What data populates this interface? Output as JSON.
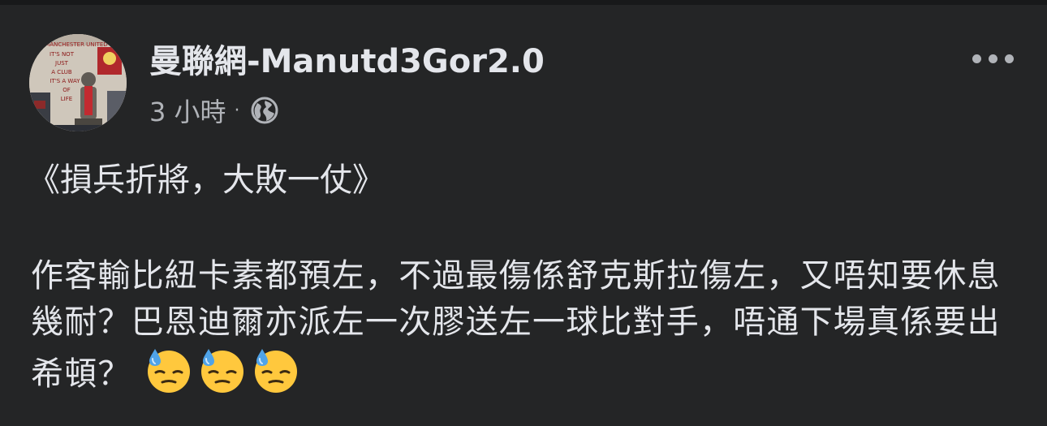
{
  "post": {
    "author": "曼聯網-Manutd3Gor2.0",
    "timestamp": "3 小時",
    "separator": "·",
    "audience_icon": "globe-icon",
    "more_icon": "more-options-icon",
    "avatar_text": [
      "MANCHESTER UNITED",
      "IT'S NOT",
      "JUST",
      "A CLUB",
      "IT'S A WAY",
      "OF",
      "LIFE"
    ],
    "title": "《損兵折將，大敗一仗》",
    "body": "作客輸比紐卡素都預左，不過最傷係舒克斯拉傷左，又唔知要休息幾耐？巴恩迪爾亦派左一次膠送左一球比對手，唔通下場真係要出希頓？",
    "emojis": [
      "downcast-face-with-sweat-icon",
      "downcast-face-with-sweat-icon",
      "downcast-face-with-sweat-icon"
    ]
  },
  "colors": {
    "background": "#242526",
    "text_primary": "#e4e6eb",
    "text_secondary": "#b0b3b8",
    "emoji_face": "#ffc83d",
    "sweat": "#4fa3e8"
  }
}
